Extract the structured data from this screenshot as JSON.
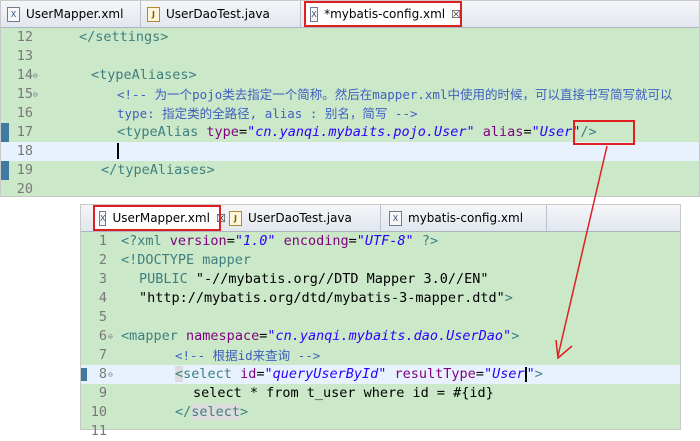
{
  "top_editor": {
    "tabs": [
      {
        "label": "UserMapper.xml",
        "icon": "xml-file-icon"
      },
      {
        "label": "UserDaoTest.java",
        "icon": "java-file-icon"
      },
      {
        "label": "*mybatis-config.xml",
        "icon": "xml-file-icon"
      }
    ],
    "close_glyph": "☒",
    "lines": [
      {
        "n": "12"
      },
      {
        "n": "13"
      },
      {
        "n": "14"
      },
      {
        "n": "15"
      },
      {
        "n": "16"
      },
      {
        "n": "17"
      },
      {
        "n": "18"
      },
      {
        "n": "19"
      },
      {
        "n": "20"
      }
    ],
    "code": {
      "l12": "</settings>",
      "l14": "<typeAliases>",
      "l15": "<!-- 为一个pojo类去指定一个简称。然后在mapper.xml中使用的时候，可以直接书写简写就可以",
      "l16": "type: 指定类的全路径, alias : 别名，简写 -->",
      "l17_tag": "<typeAlias",
      "l17_attr1": "type",
      "l17_val1": "\"cn.yanqi.mybaits.pojo.User\"",
      "l17_attr2": "alias",
      "l17_val2": "\"User\"",
      "l17_end": "/>",
      "l19": "</typeAliases>"
    }
  },
  "bottom_editor": {
    "tabs": [
      {
        "label": "UserMapper.xml",
        "icon": "xml-file-icon"
      },
      {
        "label": "UserDaoTest.java",
        "icon": "java-file-icon"
      },
      {
        "label": "mybatis-config.xml",
        "icon": "xml-file-icon"
      }
    ],
    "close_glyph": "☒",
    "lines": [
      {
        "n": "1"
      },
      {
        "n": "2"
      },
      {
        "n": "3"
      },
      {
        "n": "4"
      },
      {
        "n": "5"
      },
      {
        "n": "6"
      },
      {
        "n": "7"
      },
      {
        "n": "8"
      },
      {
        "n": "9"
      },
      {
        "n": "10"
      },
      {
        "n": "11"
      }
    ],
    "code": {
      "l1_open": "<?xml",
      "l1_a1": "version",
      "l1_v1": "\"1.0\"",
      "l1_a2": "encoding",
      "l1_v2": "\"UTF-8\"",
      "l1_close": "?>",
      "l2": "<!DOCTYPE mapper",
      "l3_kw": "PUBLIC",
      "l3_str": "\"-//mybatis.org//DTD Mapper 3.0//EN\"",
      "l4_str": "\"http://mybatis.org/dtd/mybatis-3-mapper.dtd\"",
      "l4_end": ">",
      "l6_tag": "<mapper",
      "l6_attr": "namespace",
      "l6_val": "\"cn.yanqi.mybaits.dao.UserDao\"",
      "l6_end": ">",
      "l7": "<!-- 根据id来查询 -->",
      "l8_lt": "<",
      "l8_tag": "select",
      "l8_a1": "id",
      "l8_v1": "\"queryUserById\"",
      "l8_a2": "resultType",
      "l8_v2a": "\"User",
      "l8_v2b": "\"",
      "l8_end": ">",
      "l9": "select * from t_user where id = #{id}",
      "l10_lt": "</",
      "l10_tag": "select",
      "l10_end": ">"
    }
  },
  "colors": {
    "highlight_box": "#e02020",
    "editor_bg": "#cbe8c9",
    "tag": "#3f7f7f",
    "attribute": "#7f007f",
    "value": "#2a00ff",
    "comment": "#3f5fbf"
  }
}
